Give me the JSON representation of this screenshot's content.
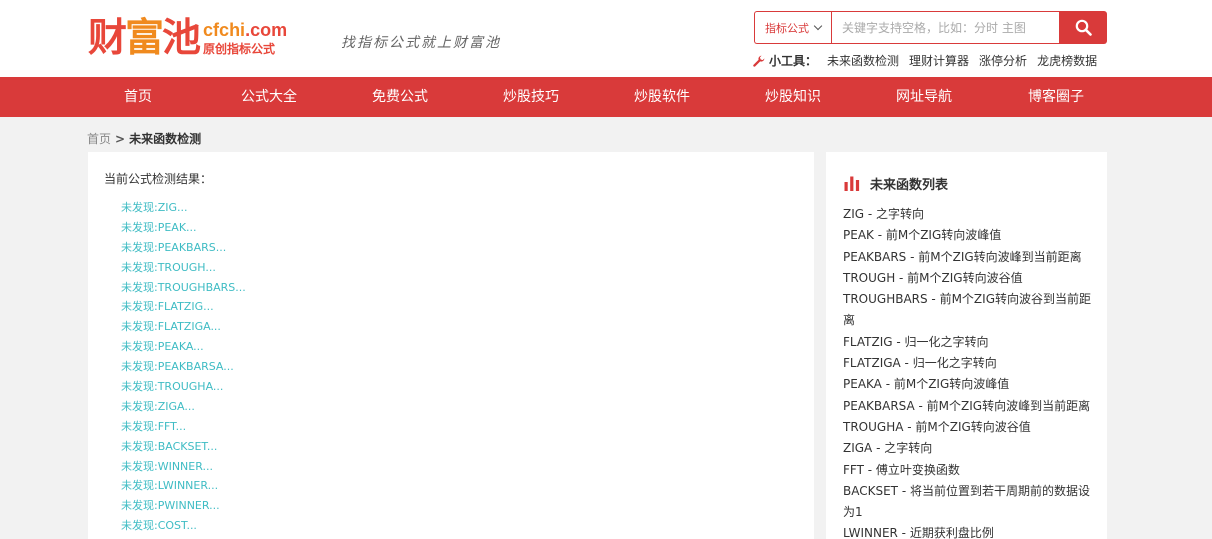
{
  "header": {
    "logo_cn": [
      "财",
      "富",
      "池"
    ],
    "logo_en_main": "cfchi",
    "logo_en_tld": ".com",
    "logo_subtitle": "原创指标公式",
    "slogan": "找指标公式就上财富池",
    "search": {
      "category": "指标公式",
      "placeholder": "关键字支持空格，比如：分时 主图"
    },
    "tools_label": "小工具：",
    "tools": [
      "未来函数检测",
      "理财计算器",
      "涨停分析",
      "龙虎榜数据"
    ]
  },
  "nav": [
    "首页",
    "公式大全",
    "免费公式",
    "炒股技巧",
    "炒股软件",
    "炒股知识",
    "网址导航",
    "博客圈子"
  ],
  "breadcrumb": {
    "home": "首页",
    "sep": ">",
    "current": "未来函数检测"
  },
  "main": {
    "result_title": "当前公式检测结果：",
    "results": [
      "未发现:ZIG...",
      "未发现:PEAK...",
      "未发现:PEAKBARS...",
      "未发现:TROUGH...",
      "未发现:TROUGHBARS...",
      "未发现:FLATZIG...",
      "未发现:FLATZIGA...",
      "未发现:PEAKA...",
      "未发现:PEAKBARSA...",
      "未发现:TROUGHA...",
      "未发现:ZIGA...",
      "未发现:FFT...",
      "未发现:BACKSET...",
      "未发现:WINNER...",
      "未发现:LWINNER...",
      "未发现:PWINNER...",
      "未发现:COST..."
    ]
  },
  "sidebar": {
    "title": "未来函数列表",
    "functions": [
      "ZIG - 之字转向",
      "PEAK - 前M个ZIG转向波峰值",
      "PEAKBARS - 前M个ZIG转向波峰到当前距离",
      "TROUGH - 前M个ZIG转向波谷值",
      "TROUGHBARS - 前M个ZIG转向波谷到当前距离",
      "FLATZIG - 归一化之字转向",
      "FLATZIGA - 归一化之字转向",
      "PEAKA - 前M个ZIG转向波峰值",
      "PEAKBARSA - 前M个ZIG转向波峰到当前距离",
      "TROUGHA - 前M个ZIG转向波谷值",
      "ZIGA - 之字转向",
      "FFT - 傅立叶变换函数",
      "BACKSET - 将当前位置到若干周期前的数据设为1",
      "LWINNER - 近期获利盘比例"
    ]
  },
  "colors": {
    "brand_red": "#d93a3a",
    "link_teal": "#3fbcc4",
    "logo_orange": "#f08a1e"
  },
  "icons": [
    "search-icon",
    "chevron-down-icon",
    "wrench-icon",
    "bar-chart-icon"
  ]
}
